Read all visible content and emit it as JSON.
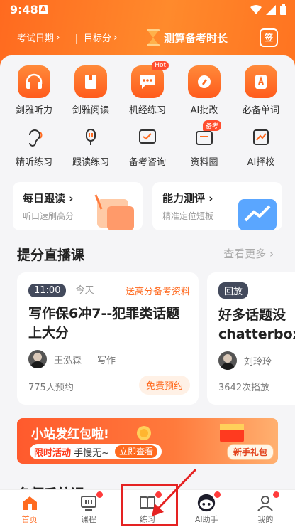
{
  "status": {
    "time": "9:48",
    "a_badge": "A"
  },
  "header": {
    "exam_date": "考试日期",
    "target_score": "目标分",
    "promo": "测算备考时长",
    "signin": "签"
  },
  "grid_row1": [
    {
      "label": "剑雅听力",
      "icon": "headphones-icon"
    },
    {
      "label": "剑雅阅读",
      "icon": "book-icon"
    },
    {
      "label": "机经练习",
      "icon": "chat-icon",
      "badge": "Hot"
    },
    {
      "label": "AI批改",
      "icon": "ai-edit-icon"
    },
    {
      "label": "必备单词",
      "icon": "word-icon"
    }
  ],
  "grid_row2": [
    {
      "label": "精听练习",
      "icon": "ear-icon"
    },
    {
      "label": "跟读练习",
      "icon": "mic-icon"
    },
    {
      "label": "备考咨询",
      "icon": "consult-icon"
    },
    {
      "label": "资料圈",
      "icon": "folder-icon",
      "badge": "备考"
    },
    {
      "label": "AI择校",
      "icon": "school-icon"
    }
  ],
  "cards": [
    {
      "title": "每日跟读",
      "sub": "听口速刷高分"
    },
    {
      "title": "能力测评",
      "sub": "精准定位短板"
    }
  ],
  "section": {
    "title": "提分直播课",
    "more": "查看更多"
  },
  "live1": {
    "time": "11:00",
    "day": "今天",
    "gift": "送高分备考资料",
    "title": "写作保6冲7--犯罪类话题上大分",
    "teacher": "王泓森",
    "subject": "写作",
    "count": "775人预约",
    "action": "免费预约"
  },
  "live2": {
    "tag": "回放",
    "title": "好多话题没chatterbox",
    "teacher": "刘玲玲",
    "count": "3642次播放"
  },
  "banner": {
    "title": "小站发红包啦!",
    "limit": "限时活动",
    "hurry": "手慢无~",
    "cta": "立即查看",
    "gift": "新手礼包"
  },
  "partial_title": "名师系统课",
  "nav": [
    {
      "label": "首页",
      "icon": "home-icon"
    },
    {
      "label": "课程",
      "icon": "course-icon"
    },
    {
      "label": "练习",
      "icon": "practice-icon"
    },
    {
      "label": "AI助手",
      "icon": "ai-assistant-icon"
    },
    {
      "label": "我的",
      "icon": "profile-icon"
    }
  ],
  "colors": {
    "accent": "#ff6a1f",
    "nav_highlight": "#e52222"
  }
}
